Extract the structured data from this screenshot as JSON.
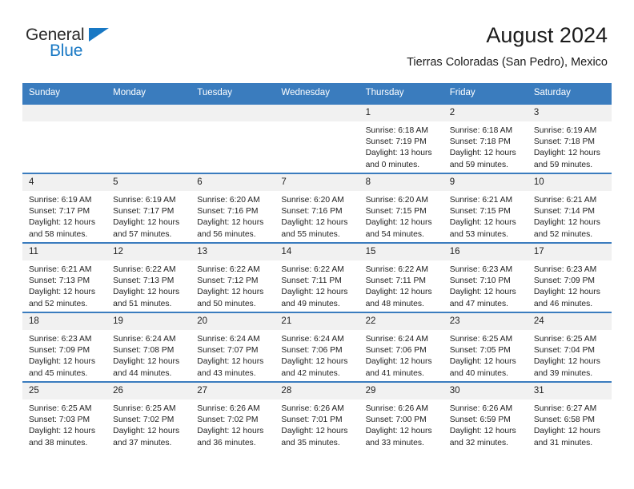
{
  "brand": {
    "logo_line1": "General",
    "logo_line2": "Blue",
    "accent_color": "#1878c4"
  },
  "header": {
    "title": "August 2024",
    "subtitle": "Tierras Coloradas (San Pedro), Mexico"
  },
  "theme": {
    "header_row_bg": "#3a7cbe",
    "daynum_bg": "#f1f1f1",
    "text_color": "#222222"
  },
  "weekdays": [
    "Sunday",
    "Monday",
    "Tuesday",
    "Wednesday",
    "Thursday",
    "Friday",
    "Saturday"
  ],
  "labels": {
    "sunrise": "Sunrise:",
    "sunset": "Sunset:",
    "daylight": "Daylight:"
  },
  "weeks": [
    [
      {
        "day": "",
        "sunrise": "",
        "sunset": "",
        "daylight1": "",
        "daylight2": ""
      },
      {
        "day": "",
        "sunrise": "",
        "sunset": "",
        "daylight1": "",
        "daylight2": ""
      },
      {
        "day": "",
        "sunrise": "",
        "sunset": "",
        "daylight1": "",
        "daylight2": ""
      },
      {
        "day": "",
        "sunrise": "",
        "sunset": "",
        "daylight1": "",
        "daylight2": ""
      },
      {
        "day": "1",
        "sunrise": "Sunrise: 6:18 AM",
        "sunset": "Sunset: 7:19 PM",
        "daylight1": "Daylight: 13 hours",
        "daylight2": "and 0 minutes."
      },
      {
        "day": "2",
        "sunrise": "Sunrise: 6:18 AM",
        "sunset": "Sunset: 7:18 PM",
        "daylight1": "Daylight: 12 hours",
        "daylight2": "and 59 minutes."
      },
      {
        "day": "3",
        "sunrise": "Sunrise: 6:19 AM",
        "sunset": "Sunset: 7:18 PM",
        "daylight1": "Daylight: 12 hours",
        "daylight2": "and 59 minutes."
      }
    ],
    [
      {
        "day": "4",
        "sunrise": "Sunrise: 6:19 AM",
        "sunset": "Sunset: 7:17 PM",
        "daylight1": "Daylight: 12 hours",
        "daylight2": "and 58 minutes."
      },
      {
        "day": "5",
        "sunrise": "Sunrise: 6:19 AM",
        "sunset": "Sunset: 7:17 PM",
        "daylight1": "Daylight: 12 hours",
        "daylight2": "and 57 minutes."
      },
      {
        "day": "6",
        "sunrise": "Sunrise: 6:20 AM",
        "sunset": "Sunset: 7:16 PM",
        "daylight1": "Daylight: 12 hours",
        "daylight2": "and 56 minutes."
      },
      {
        "day": "7",
        "sunrise": "Sunrise: 6:20 AM",
        "sunset": "Sunset: 7:16 PM",
        "daylight1": "Daylight: 12 hours",
        "daylight2": "and 55 minutes."
      },
      {
        "day": "8",
        "sunrise": "Sunrise: 6:20 AM",
        "sunset": "Sunset: 7:15 PM",
        "daylight1": "Daylight: 12 hours",
        "daylight2": "and 54 minutes."
      },
      {
        "day": "9",
        "sunrise": "Sunrise: 6:21 AM",
        "sunset": "Sunset: 7:15 PM",
        "daylight1": "Daylight: 12 hours",
        "daylight2": "and 53 minutes."
      },
      {
        "day": "10",
        "sunrise": "Sunrise: 6:21 AM",
        "sunset": "Sunset: 7:14 PM",
        "daylight1": "Daylight: 12 hours",
        "daylight2": "and 52 minutes."
      }
    ],
    [
      {
        "day": "11",
        "sunrise": "Sunrise: 6:21 AM",
        "sunset": "Sunset: 7:13 PM",
        "daylight1": "Daylight: 12 hours",
        "daylight2": "and 52 minutes."
      },
      {
        "day": "12",
        "sunrise": "Sunrise: 6:22 AM",
        "sunset": "Sunset: 7:13 PM",
        "daylight1": "Daylight: 12 hours",
        "daylight2": "and 51 minutes."
      },
      {
        "day": "13",
        "sunrise": "Sunrise: 6:22 AM",
        "sunset": "Sunset: 7:12 PM",
        "daylight1": "Daylight: 12 hours",
        "daylight2": "and 50 minutes."
      },
      {
        "day": "14",
        "sunrise": "Sunrise: 6:22 AM",
        "sunset": "Sunset: 7:11 PM",
        "daylight1": "Daylight: 12 hours",
        "daylight2": "and 49 minutes."
      },
      {
        "day": "15",
        "sunrise": "Sunrise: 6:22 AM",
        "sunset": "Sunset: 7:11 PM",
        "daylight1": "Daylight: 12 hours",
        "daylight2": "and 48 minutes."
      },
      {
        "day": "16",
        "sunrise": "Sunrise: 6:23 AM",
        "sunset": "Sunset: 7:10 PM",
        "daylight1": "Daylight: 12 hours",
        "daylight2": "and 47 minutes."
      },
      {
        "day": "17",
        "sunrise": "Sunrise: 6:23 AM",
        "sunset": "Sunset: 7:09 PM",
        "daylight1": "Daylight: 12 hours",
        "daylight2": "and 46 minutes."
      }
    ],
    [
      {
        "day": "18",
        "sunrise": "Sunrise: 6:23 AM",
        "sunset": "Sunset: 7:09 PM",
        "daylight1": "Daylight: 12 hours",
        "daylight2": "and 45 minutes."
      },
      {
        "day": "19",
        "sunrise": "Sunrise: 6:24 AM",
        "sunset": "Sunset: 7:08 PM",
        "daylight1": "Daylight: 12 hours",
        "daylight2": "and 44 minutes."
      },
      {
        "day": "20",
        "sunrise": "Sunrise: 6:24 AM",
        "sunset": "Sunset: 7:07 PM",
        "daylight1": "Daylight: 12 hours",
        "daylight2": "and 43 minutes."
      },
      {
        "day": "21",
        "sunrise": "Sunrise: 6:24 AM",
        "sunset": "Sunset: 7:06 PM",
        "daylight1": "Daylight: 12 hours",
        "daylight2": "and 42 minutes."
      },
      {
        "day": "22",
        "sunrise": "Sunrise: 6:24 AM",
        "sunset": "Sunset: 7:06 PM",
        "daylight1": "Daylight: 12 hours",
        "daylight2": "and 41 minutes."
      },
      {
        "day": "23",
        "sunrise": "Sunrise: 6:25 AM",
        "sunset": "Sunset: 7:05 PM",
        "daylight1": "Daylight: 12 hours",
        "daylight2": "and 40 minutes."
      },
      {
        "day": "24",
        "sunrise": "Sunrise: 6:25 AM",
        "sunset": "Sunset: 7:04 PM",
        "daylight1": "Daylight: 12 hours",
        "daylight2": "and 39 minutes."
      }
    ],
    [
      {
        "day": "25",
        "sunrise": "Sunrise: 6:25 AM",
        "sunset": "Sunset: 7:03 PM",
        "daylight1": "Daylight: 12 hours",
        "daylight2": "and 38 minutes."
      },
      {
        "day": "26",
        "sunrise": "Sunrise: 6:25 AM",
        "sunset": "Sunset: 7:02 PM",
        "daylight1": "Daylight: 12 hours",
        "daylight2": "and 37 minutes."
      },
      {
        "day": "27",
        "sunrise": "Sunrise: 6:26 AM",
        "sunset": "Sunset: 7:02 PM",
        "daylight1": "Daylight: 12 hours",
        "daylight2": "and 36 minutes."
      },
      {
        "day": "28",
        "sunrise": "Sunrise: 6:26 AM",
        "sunset": "Sunset: 7:01 PM",
        "daylight1": "Daylight: 12 hours",
        "daylight2": "and 35 minutes."
      },
      {
        "day": "29",
        "sunrise": "Sunrise: 6:26 AM",
        "sunset": "Sunset: 7:00 PM",
        "daylight1": "Daylight: 12 hours",
        "daylight2": "and 33 minutes."
      },
      {
        "day": "30",
        "sunrise": "Sunrise: 6:26 AM",
        "sunset": "Sunset: 6:59 PM",
        "daylight1": "Daylight: 12 hours",
        "daylight2": "and 32 minutes."
      },
      {
        "day": "31",
        "sunrise": "Sunrise: 6:27 AM",
        "sunset": "Sunset: 6:58 PM",
        "daylight1": "Daylight: 12 hours",
        "daylight2": "and 31 minutes."
      }
    ]
  ]
}
